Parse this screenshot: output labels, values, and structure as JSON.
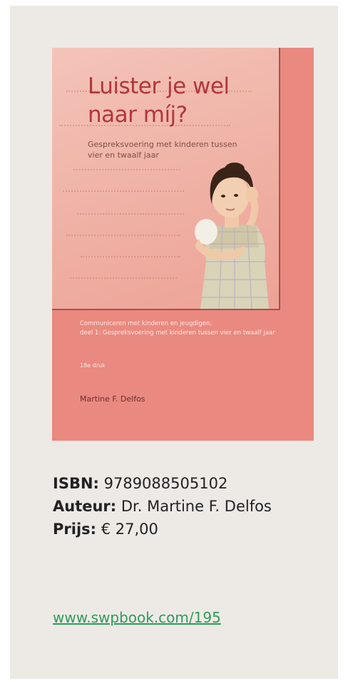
{
  "cover": {
    "title": "Luister je wel naar míj?",
    "subtitle": "Gespreksvoering met kinderen tussen vier en twaalf jaar",
    "series_line1": "Communiceren met kinderen en jeugdigen,",
    "series_line2": "deel 1: Gespreksvoering met kinderen tussen vier en twaalf jaar",
    "edition": "18e druk",
    "author": "Martine F. Delfos"
  },
  "info": {
    "isbn_label": "ISBN:",
    "isbn_value": "9789088505102",
    "author_label": "Auteur:",
    "author_value": "Dr. Martine F. Delfos",
    "price_label": "Prijs:",
    "price_value": "€ 27,00"
  },
  "link": {
    "text": "www.swpbook.com/195"
  },
  "colors": {
    "cover_bg": "#e9897f",
    "title": "#b2363e",
    "link": "#2e9c5a"
  }
}
